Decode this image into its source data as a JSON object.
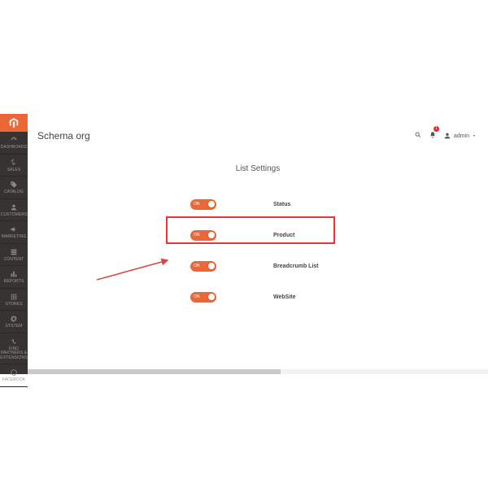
{
  "colors": {
    "accent": "#ec6737",
    "sidebar_bg": "#373330",
    "highlight": "#e33"
  },
  "sidebar": {
    "items": [
      {
        "label": "DASHBOARD",
        "icon": "gauge-icon"
      },
      {
        "label": "SALES",
        "icon": "dollar-icon"
      },
      {
        "label": "CATALOG",
        "icon": "tag-icon"
      },
      {
        "label": "CUSTOMERS",
        "icon": "person-icon"
      },
      {
        "label": "MARKETING",
        "icon": "megaphone-icon"
      },
      {
        "label": "CONTENT",
        "icon": "layers-icon"
      },
      {
        "label": "REPORTS",
        "icon": "bars-icon"
      },
      {
        "label": "STORES",
        "icon": "stores-icon"
      },
      {
        "label": "SYSTEM",
        "icon": "gear-icon"
      },
      {
        "label": "FIND PARTNERS & EXTENSIONS",
        "icon": "link-icon"
      },
      {
        "label": "FACEBOOK",
        "icon": "circle-icon"
      }
    ]
  },
  "header": {
    "title": "Schema org",
    "notifications_count": "1",
    "user_label": "admin"
  },
  "main": {
    "section_title": "List Settings",
    "rows": [
      {
        "toggle_label": "ON",
        "label": "Status"
      },
      {
        "toggle_label": "ON",
        "label": "Product"
      },
      {
        "toggle_label": "ON",
        "label": "Breadcrumb List"
      },
      {
        "toggle_label": "ON",
        "label": "WebSite"
      }
    ]
  }
}
